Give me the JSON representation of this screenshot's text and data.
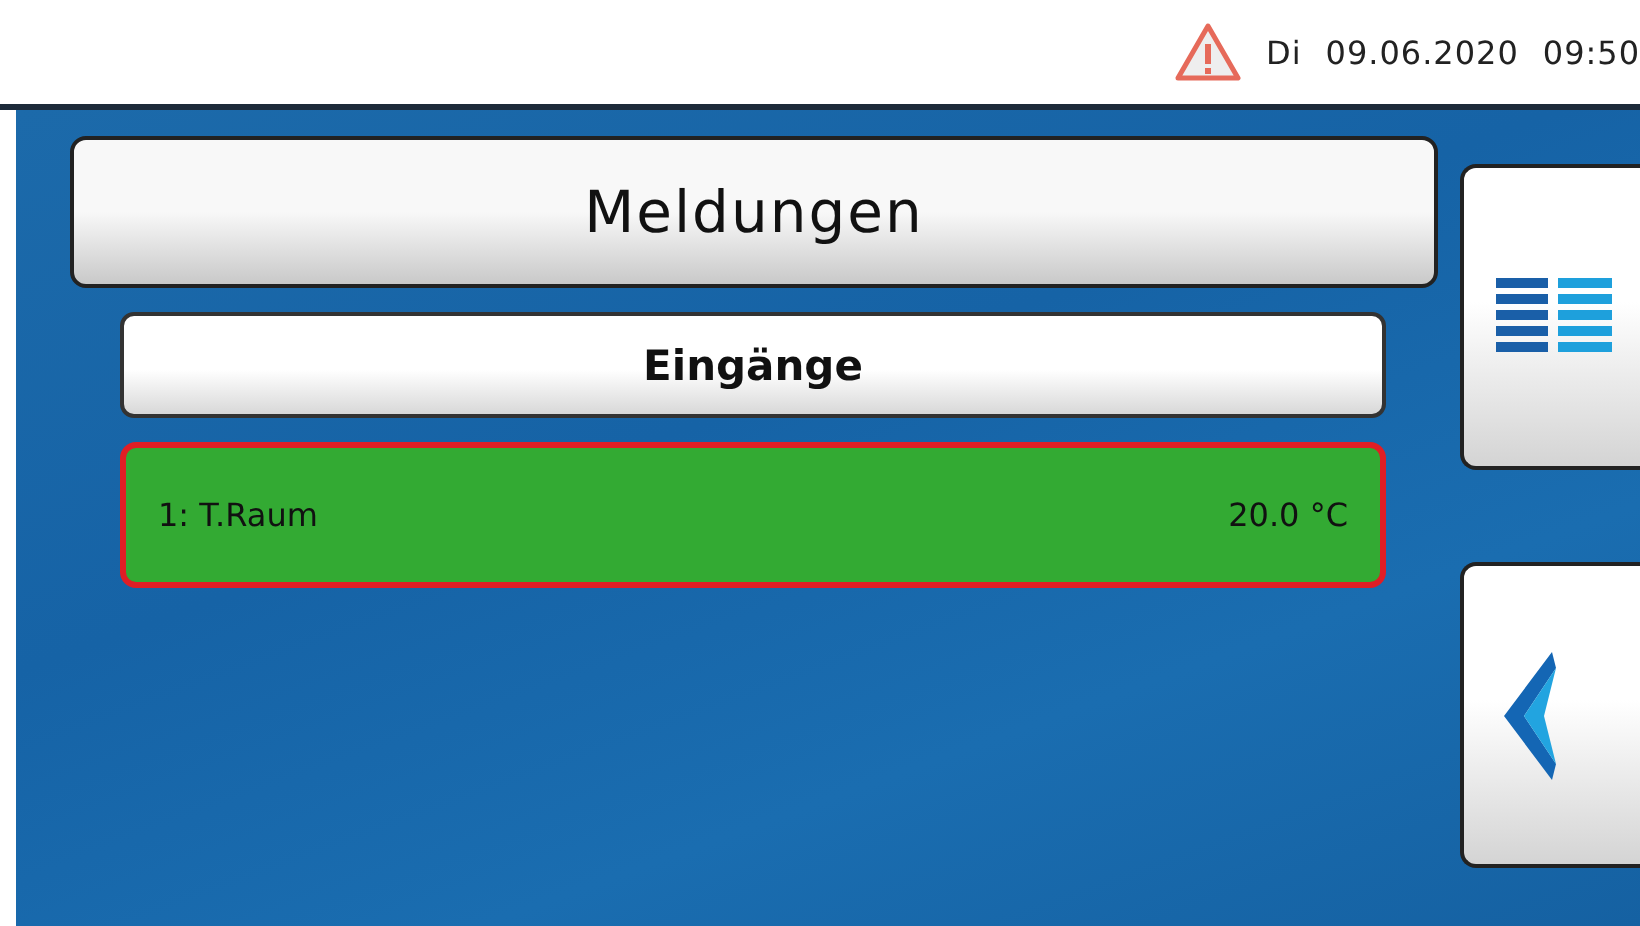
{
  "status_bar": {
    "weekday": "Di",
    "date": "09.06.2020",
    "time": "09:50",
    "warning": true
  },
  "title": "Meldungen",
  "section": "Eingänge",
  "messages": [
    {
      "label": "1: T.Raum",
      "value": "20.0 °C",
      "alarm": true
    }
  ],
  "side_buttons": [
    {
      "kind": "menu"
    },
    {
      "kind": "back"
    }
  ]
}
